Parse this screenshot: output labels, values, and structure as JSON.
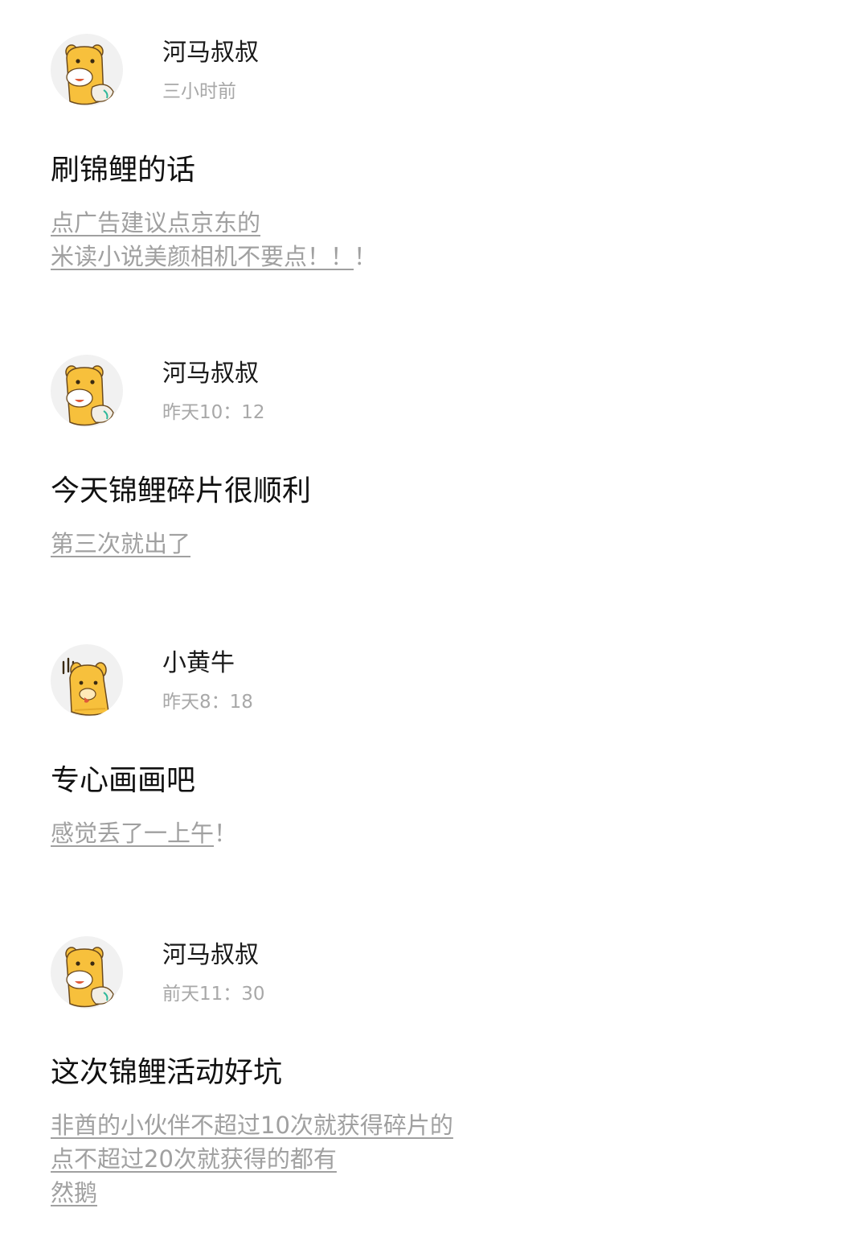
{
  "posts": [
    {
      "author": "河马叔叔",
      "avatar_icon": "hippo-avatar-icon",
      "time": "三小时前",
      "title": "刷锦鲤的话",
      "lines": [
        {
          "link": "点广告建议点京东的",
          "tail": ""
        },
        {
          "link": "米读小说美颜相机不要点！！",
          "tail": "！"
        }
      ]
    },
    {
      "author": "河马叔叔",
      "avatar_icon": "hippo-avatar-icon",
      "time": "昨天10：12",
      "title": "今天锦鲤碎片很顺利",
      "lines": [
        {
          "link": "第三次就出了",
          "tail": ""
        }
      ]
    },
    {
      "author": "小黄牛",
      "avatar_icon": "yellow-calf-avatar-icon",
      "time": "昨天8：18",
      "title": "专心画画吧",
      "lines": [
        {
          "link": "感觉丢了一上午",
          "tail": "！"
        }
      ]
    },
    {
      "author": "河马叔叔",
      "avatar_icon": "hippo-avatar-icon",
      "time": "前天11：30",
      "title": "这次锦鲤活动好坑",
      "lines": [
        {
          "link": "非酋的小伙伴不超过10次就获得碎片的",
          "tail": ""
        },
        {
          "link": "点不超过20次就获得的都有",
          "tail": ""
        },
        {
          "link": "然鹅",
          "tail": ""
        }
      ]
    }
  ],
  "colors": {
    "author": "#1a1a1a",
    "time": "#a8a8a8",
    "title": "#111111",
    "body": "#a0a0a0",
    "avatar_bg": "#f1f1f1",
    "mascot": "#f7c03c"
  }
}
